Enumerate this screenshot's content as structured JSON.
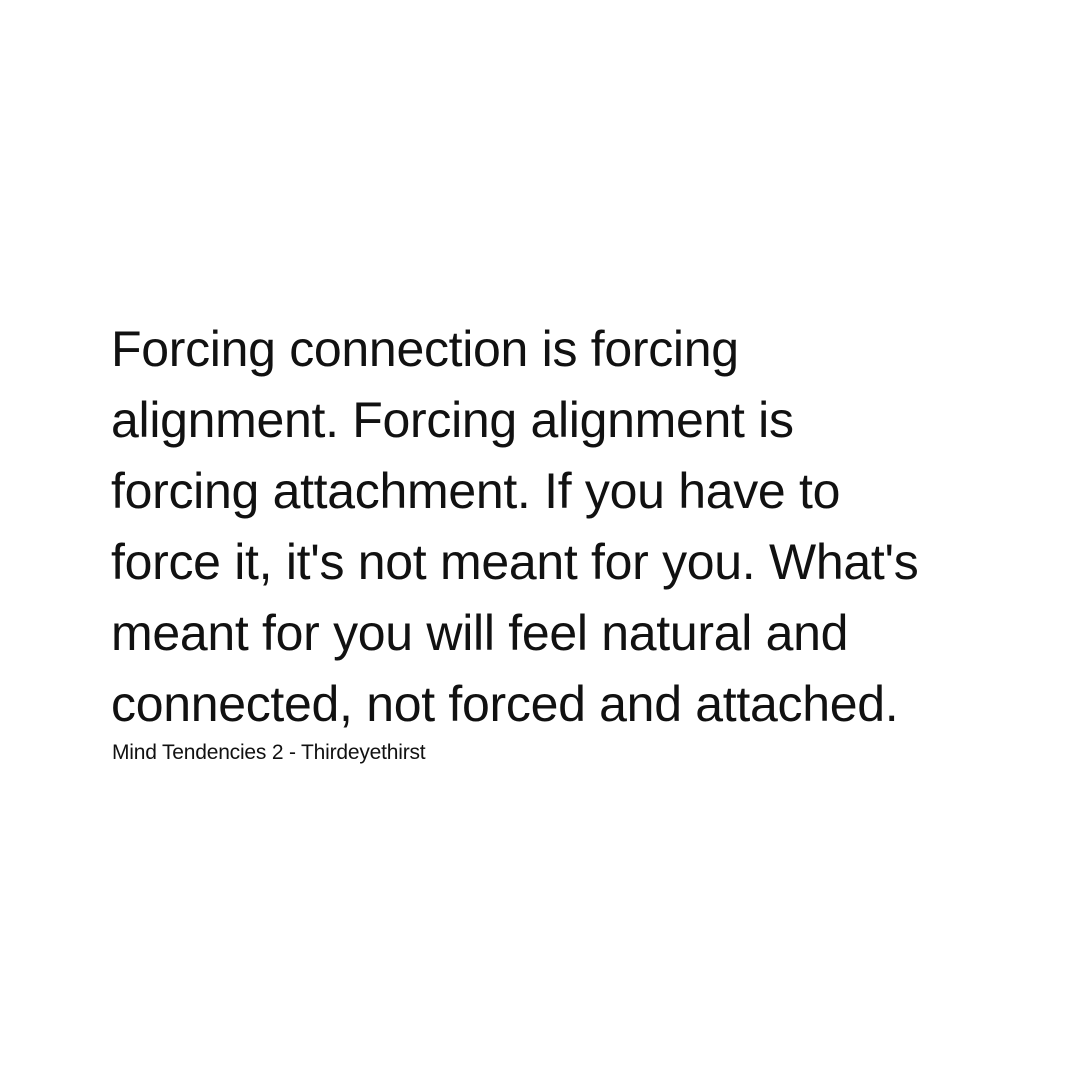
{
  "quote": {
    "lines": [
      "Forcing connection is forcing",
      "alignment. Forcing alignment is",
      "forcing attachment. If you have to",
      "force it, it's not meant for you. What's",
      "meant for you will feel natural and",
      "connected, not forced and attached."
    ]
  },
  "attribution": "Mind Tendencies 2 - Thirdeyethirst",
  "colors": {
    "background": "#ffffff",
    "text": "#111111"
  }
}
